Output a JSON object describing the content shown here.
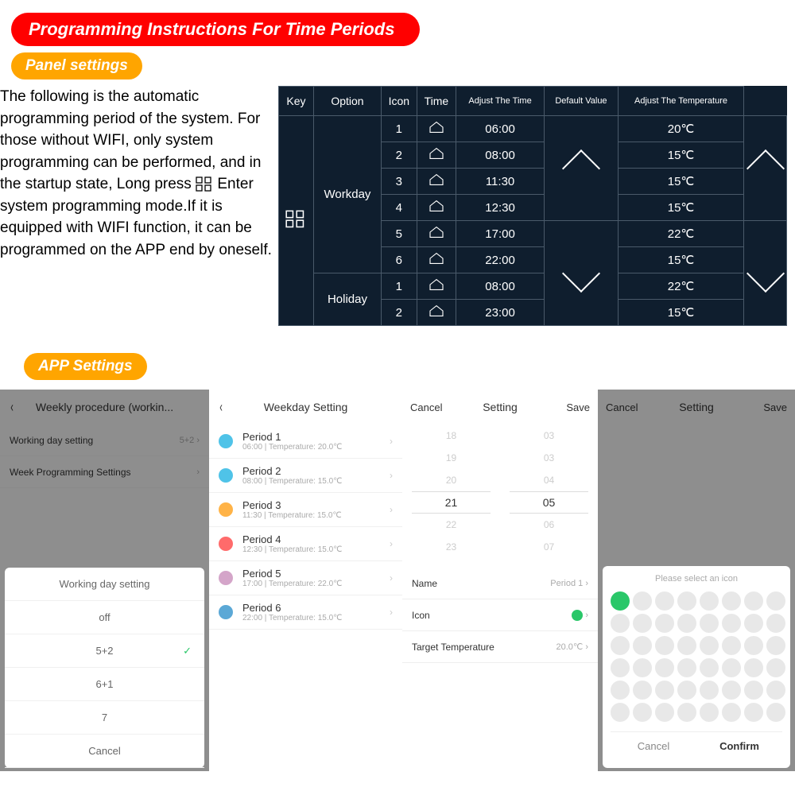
{
  "title": "Programming Instructions For Time Periods",
  "sub_panel": "Panel settings",
  "sub_app": "APP Settings",
  "desc_a": "The following is the automatic programming period of the system. For those without WIFI, only system programming can be performed, and in the startup state, Long press ",
  "desc_b": " Enter system programming mode.If it is equipped with WIFI function, it can be programmed on the APP end by oneself.",
  "table": {
    "headers": {
      "key": "Key",
      "option": "Option",
      "icon": "Icon",
      "time": "Time",
      "adjtime": "Adjust The Time",
      "default": "Default Value",
      "adjtemp": "Adjust The Temperature"
    },
    "workday_label": "Workday",
    "holiday_label": "Holiday",
    "workday": [
      {
        "n": "1",
        "time": "06:00",
        "temp": "20℃"
      },
      {
        "n": "2",
        "time": "08:00",
        "temp": "15℃"
      },
      {
        "n": "3",
        "time": "11:30",
        "temp": "15℃"
      },
      {
        "n": "4",
        "time": "12:30",
        "temp": "15℃"
      },
      {
        "n": "5",
        "time": "17:00",
        "temp": "22℃"
      },
      {
        "n": "6",
        "time": "22:00",
        "temp": "15℃"
      }
    ],
    "holiday": [
      {
        "n": "1",
        "time": "08:00",
        "temp": "22℃"
      },
      {
        "n": "2",
        "time": "23:00",
        "temp": "15℃"
      }
    ]
  },
  "app1": {
    "title": "Weekly procedure (workin...",
    "rows": [
      {
        "lbl": "Working day setting",
        "val": "5+2 ›"
      },
      {
        "lbl": "Week Programming Settings",
        "val": "›"
      }
    ],
    "sheet_title": "Working day setting",
    "opts": [
      "off",
      "5+2",
      "6+1",
      "7"
    ],
    "selected": "5+2",
    "cancel": "Cancel"
  },
  "app2": {
    "title": "Weekday Setting",
    "periods": [
      {
        "name": "Period 1",
        "sub": "06:00  |  Temperature: 20.0℃",
        "col": "#4fc3e8"
      },
      {
        "name": "Period 2",
        "sub": "08:00  |  Temperature: 15.0℃",
        "col": "#4fc3e8"
      },
      {
        "name": "Period 3",
        "sub": "11:30  |  Temperature: 15.0℃",
        "col": "#ffb347"
      },
      {
        "name": "Period 4",
        "sub": "12:30  |  Temperature: 15.0℃",
        "col": "#ff6b6b"
      },
      {
        "name": "Period 5",
        "sub": "17:00  |  Temperature: 22.0℃",
        "col": "#d4a5c9"
      },
      {
        "name": "Period 6",
        "sub": "22:00  |  Temperature: 15.0℃",
        "col": "#5ba8d6"
      }
    ]
  },
  "app3": {
    "title": "Setting",
    "cancel": "Cancel",
    "save": "Save",
    "left": [
      "18",
      "19",
      "20",
      "21",
      "22",
      "23"
    ],
    "right": [
      "03",
      "03",
      "04",
      "05",
      "06",
      "07"
    ],
    "sel_l": "21",
    "sel_r": "05",
    "rows": [
      {
        "lbl": "Name",
        "val": "Period 1 ›"
      },
      {
        "lbl": "Icon",
        "val": "›"
      },
      {
        "lbl": "Target Temperature",
        "val": "20.0℃ ›"
      }
    ]
  },
  "app4": {
    "title": "Setting",
    "cancel": "Cancel",
    "save": "Save",
    "sheet_title": "Please select an icon",
    "confirm": "Confirm",
    "cancel_btn": "Cancel"
  }
}
